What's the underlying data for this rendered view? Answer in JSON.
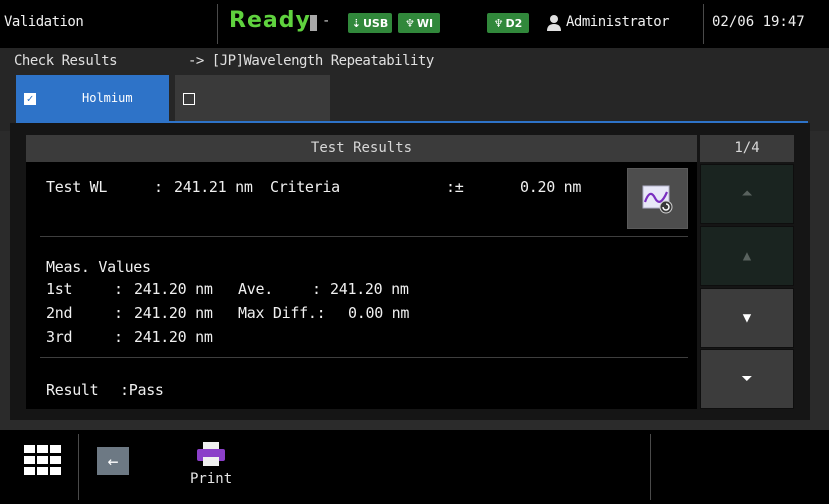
{
  "header": {
    "app_title": "Validation",
    "status": "Ready",
    "status_indicator": "-",
    "chips": [
      {
        "label": "USB",
        "icon": "usb-icon"
      },
      {
        "label": "WI",
        "icon": "lamp-icon"
      },
      {
        "label": "D2",
        "icon": "lamp-icon"
      }
    ],
    "user": "Administrator",
    "datetime": "02/06 19:47"
  },
  "breadcrumb": {
    "section": "Check Results",
    "test": "-> [JP]Wavelength Repeatability"
  },
  "tabs": [
    {
      "label": "Holmium",
      "checked": true
    },
    {
      "label": "",
      "checked": false
    }
  ],
  "results": {
    "title": "Test Results",
    "page": "1/4",
    "test_wl_label": "Test WL",
    "test_wl_sep": ":",
    "test_wl_value": "241.21 nm",
    "criteria_label": "Criteria",
    "criteria_sep": ":±",
    "criteria_value": "0.20 nm",
    "meas_title": "Meas. Values",
    "measurements": [
      {
        "label": "1st",
        "sep": ":",
        "value": "241.20 nm"
      },
      {
        "label": "2nd",
        "sep": ":",
        "value": "241.20 nm"
      },
      {
        "label": "3rd",
        "sep": ":",
        "value": "241.20 nm"
      }
    ],
    "ave_label": "Ave.",
    "ave_sep": ":",
    "ave_value": "241.20 nm",
    "maxdiff_label": "Max Diff.:",
    "maxdiff_value": "0.00 nm",
    "result_label": "Result",
    "result_value": ":Pass"
  },
  "nav": {
    "first_icon": "double-up-icon",
    "up_icon": "up-icon",
    "down_icon": "down-icon",
    "last_icon": "double-down-icon",
    "first_glyph": "⏶",
    "up_glyph": "▲",
    "down_glyph": "▼",
    "last_glyph": "⏷"
  },
  "footer": {
    "print_label": "Print",
    "back_glyph": "←"
  },
  "colors": {
    "ready": "#5fd23e",
    "accent": "#2e73c8",
    "chip": "#31883b"
  }
}
